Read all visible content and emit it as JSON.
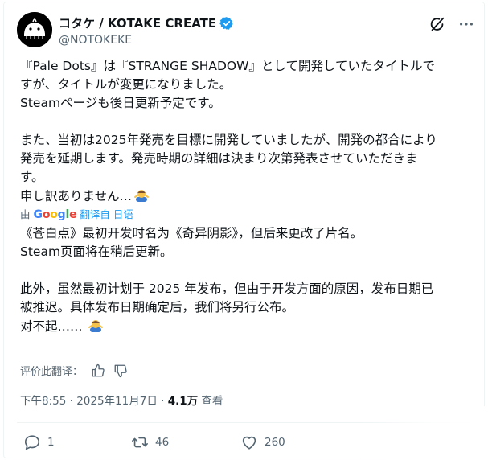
{
  "author": {
    "display_name": "コタケ / KOTAKE CREATE",
    "handle": "@NOTOKEKE"
  },
  "icons": {
    "avatar": "whale-logo-avatar",
    "verified": "verified-badge-icon",
    "grok": "grok-icon",
    "more": "more-icon"
  },
  "tweet": {
    "lines": [
      "『Pale Dots』は『STRANGE SHADOW』として開発していたタイトルで",
      "すが、タイトルが変更になりました。",
      "Steamページも後日更新予定です。",
      "",
      "また、当初は2025年発売を目標に開発していましたが、開発の都合により",
      "発売を延期します。発売時期の詳細は決まり次第発表させていただきま",
      "す。",
      "申し訳ありません…"
    ]
  },
  "translation": {
    "prefix": "由",
    "google": [
      "G",
      "o",
      "o",
      "g",
      "l",
      "e"
    ],
    "suffix": "翻译自 日语",
    "lines": [
      "《苍白点》最初开发时名为《奇异阴影》，但后来更改了片名。",
      "Steam页面将在稍后更新。",
      "",
      "此外，虽然最初计划于 2025 年发布，但由于开发方面的原因，发布日期已",
      "被推迟。具体发布日期确定后，我们将另行公布。",
      "对不起……"
    ]
  },
  "rate": {
    "label": "评价此翻译："
  },
  "meta": {
    "time": "下午8:55",
    "separator1": " · ",
    "date": "2025年11月7日",
    "separator2": " · ",
    "views_count": "4.1万",
    "views_label": " 查看"
  },
  "actions": {
    "reply_count": "1",
    "repost_count": "46",
    "like_count": "260"
  },
  "colors": {
    "text": "#0f1419",
    "secondary": "#536471",
    "verified": "#1d9bf0",
    "translate_link": "#1d9bf0"
  }
}
